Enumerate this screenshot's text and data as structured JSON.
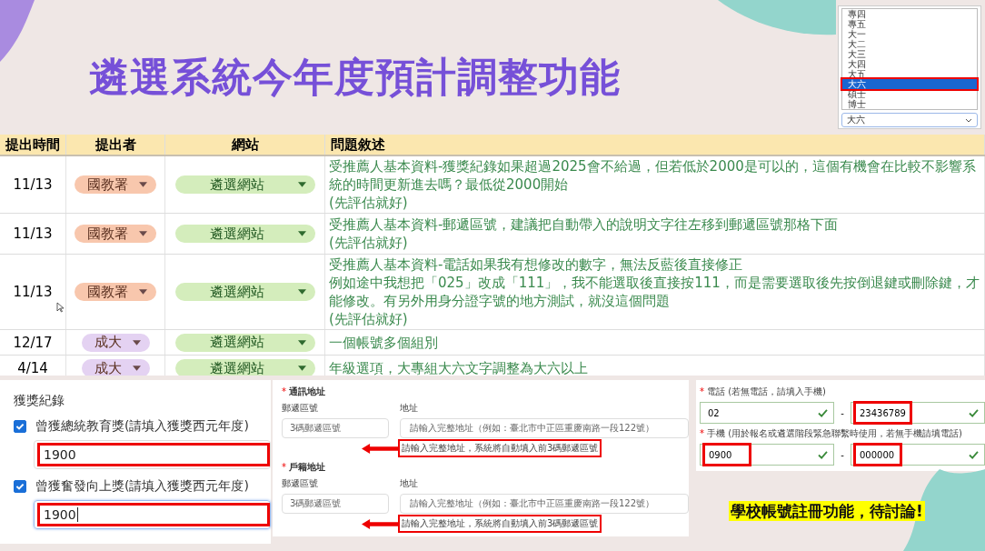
{
  "title": "遴選系統今年度預計調整功能",
  "dropdown": {
    "items": [
      {
        "label": "專四",
        "selected": false
      },
      {
        "label": "專五",
        "selected": false
      },
      {
        "label": "大一",
        "selected": false
      },
      {
        "label": "大二",
        "selected": false
      },
      {
        "label": "大三",
        "selected": false
      },
      {
        "label": "大四",
        "selected": false
      },
      {
        "label": "大五",
        "selected": false
      },
      {
        "label": "大六",
        "selected": true
      },
      {
        "label": "碩士",
        "selected": false
      },
      {
        "label": "博士",
        "selected": false
      }
    ],
    "value": "大六"
  },
  "table": {
    "columns": [
      "提出時間",
      "提出者",
      "網站",
      "問題敘述"
    ],
    "rows": [
      {
        "date": "11/13",
        "submitter": {
          "label": "國教署",
          "color": "#f8c7ad"
        },
        "website": "遴選網站",
        "description": [
          "受推薦人基本資料-獲獎紀錄如果超過2025會不給過，但若低於2000是可以的，這個有機會在比較不影響系統的時間更新進去嗎？最低從2000開始",
          "(先評估就好)"
        ]
      },
      {
        "date": "11/13",
        "submitter": {
          "label": "國教署",
          "color": "#f8c7ad"
        },
        "website": "遴選網站",
        "description": [
          "受推薦人基本資料-郵遞區號，建議把自動帶入的說明文字往左移到郵遞區號那格下面",
          "(先評估就好)"
        ]
      },
      {
        "date": "11/13",
        "submitter": {
          "label": "國教署",
          "color": "#f8c7ad"
        },
        "website": "遴選網站",
        "description": [
          "受推薦人基本資料-電話如果我有想修改的數字，無法反藍後直接修正",
          "例如途中我想把「025」改成「111」，我不能選取後直接按111，而是需要選取後先按倒退鍵或刪除鍵，才能修改。有另外用身分證字號的地方測試，就沒這個問題",
          "(先評估就好)"
        ]
      },
      {
        "date": "12/17",
        "submitter": {
          "label": "成大",
          "color": "#e4d2f2"
        },
        "website": "遴選網站",
        "description": [
          "一個帳號多個組別"
        ]
      },
      {
        "date": "4/14",
        "submitter": {
          "label": "成大",
          "color": "#e4d2f2"
        },
        "website": "遴選網站",
        "description": [
          "年級選項，大專組大六文字調整為大六以上"
        ]
      }
    ]
  },
  "awards": {
    "heading": "獲獎紀錄",
    "items": [
      {
        "label": "曾獲總統教育獎(請填入獲獎西元年度)",
        "checked": true,
        "value": "1900",
        "focused": false
      },
      {
        "label": "曾獲奮發向上獎(請填入獲獎西元年度)",
        "checked": true,
        "value": "1900",
        "focused": true
      }
    ]
  },
  "addresses": [
    {
      "mark": "*",
      "title": "通訊地址",
      "zip_label": "郵遞區號",
      "zip_placeholder": "3碼郵遞區號",
      "addr_label": "地址",
      "addr_placeholder": "請輸入完整地址（例如：臺北市中正區重慶南路一段122號）",
      "hint": "請輸入完整地址，系統將自動填入前3碼郵遞區號"
    },
    {
      "mark": "*",
      "title": "戶籍地址",
      "zip_label": "郵遞區號",
      "zip_placeholder": "3碼郵遞區號",
      "addr_label": "地址",
      "addr_placeholder": "請輸入完整地址（例如：臺北市中正區重慶南路一段122號）",
      "hint": "請輸入完整地址，系統將自動填入前3碼郵遞區號"
    }
  ],
  "phones": [
    {
      "mark": "*",
      "label": "電話 (若無電話，請填入手機)",
      "separator": "-",
      "parts": [
        {
          "value": "02",
          "highlighted": false
        },
        {
          "value": "23436789",
          "highlighted": true
        }
      ]
    },
    {
      "mark": "*",
      "label": "手機 (用於報名或遴選階段緊急聯繫時使用，若無手機請填電話)",
      "separator": "-",
      "parts": [
        {
          "value": "0900",
          "highlighted": true
        },
        {
          "value": "000000",
          "highlighted": true
        }
      ]
    }
  ],
  "callout": "學校帳號註冊功能，待討論!"
}
